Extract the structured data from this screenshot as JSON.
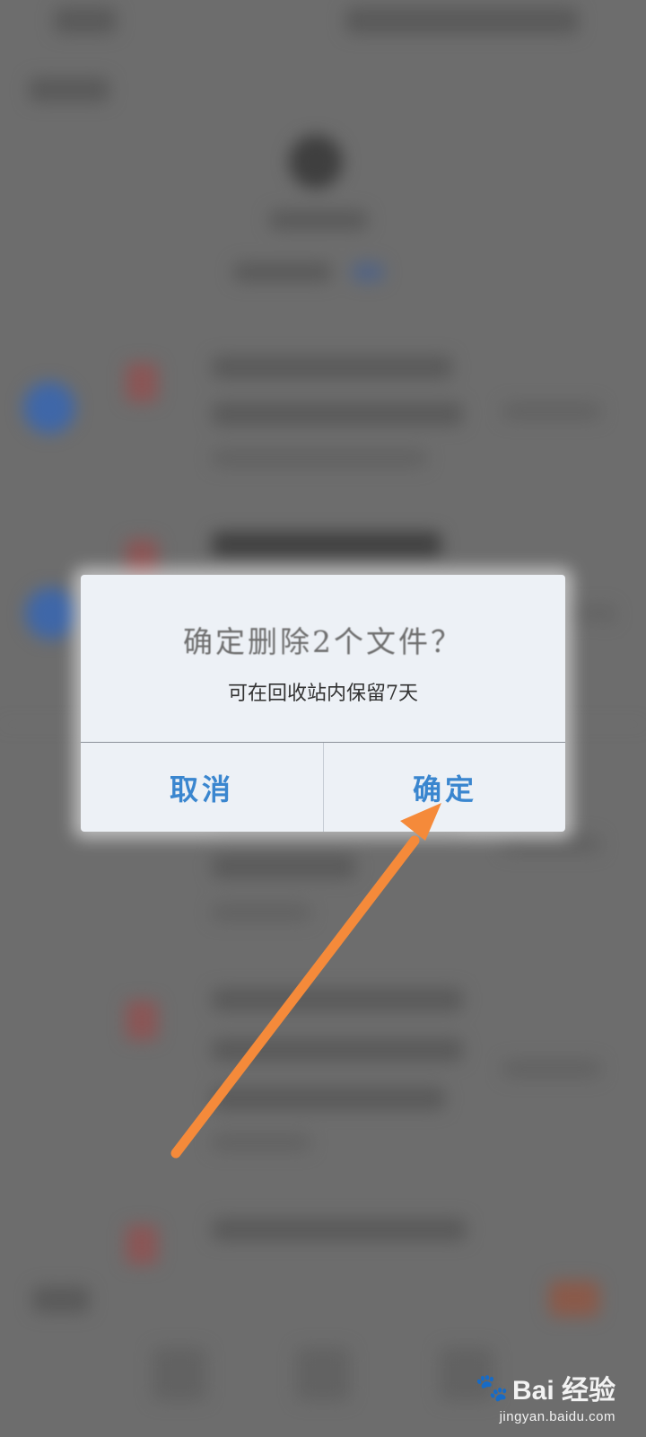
{
  "dialog": {
    "title": "确定删除2个文件？",
    "message": "可在回收站内保留7天",
    "cancel_label": "取消",
    "confirm_label": "确定"
  },
  "background": {
    "visible_size_fragment": "6MB"
  },
  "annotation": {
    "color": "#f58a3a",
    "target": "confirm-button"
  },
  "watermark": {
    "brand": "Bai 经验",
    "url": "jingyan.baidu.com"
  },
  "colors": {
    "accent": "#3a86cf",
    "overlay": "#6d6d6d",
    "dialog_bg": "#edf1f6"
  }
}
